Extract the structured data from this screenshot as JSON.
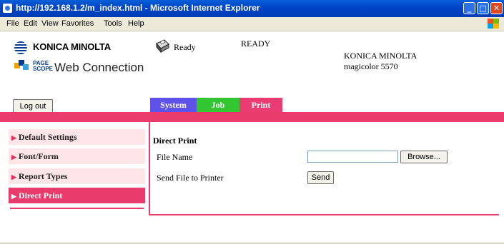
{
  "window": {
    "title": "http://192.168.1.2/m_index.html - Microsoft Internet Explorer",
    "controls": {
      "minimize": "_",
      "maximize": "□",
      "close": "✕"
    }
  },
  "menu": [
    "File",
    "Edit",
    "View",
    "Favorites",
    "Tools",
    "Help"
  ],
  "header": {
    "logo_text": "KONICA MINOLTA",
    "pagescope_line1": "PAGE",
    "pagescope_line2": "SCOPE",
    "web_connection": "Web Connection",
    "printer_state": "Ready",
    "status": "READY",
    "brand": "KONICA MINOLTA",
    "model": "magicolor 5570"
  },
  "buttons": {
    "logout": "Log out",
    "browse": "Browse...",
    "send": "Send"
  },
  "tabs": [
    {
      "label": "System",
      "color": "#5f52e8"
    },
    {
      "label": "Job",
      "color": "#33c633"
    },
    {
      "label": "Print",
      "color": "#ea3c73"
    }
  ],
  "sidebar": {
    "items": [
      {
        "label": "Default Settings",
        "active": false
      },
      {
        "label": "Font/Form",
        "active": false
      },
      {
        "label": "Report Types",
        "active": false
      },
      {
        "label": "Direct Print",
        "active": true
      }
    ]
  },
  "main": {
    "title": "Direct Print",
    "file_name_label": "File Name",
    "file_name_value": "",
    "send_label": "Send File to Printer"
  },
  "colors": {
    "accent": "#ea3c6c",
    "sidebar_bg": "#fde5e8",
    "titlebar": "#0046c8"
  }
}
